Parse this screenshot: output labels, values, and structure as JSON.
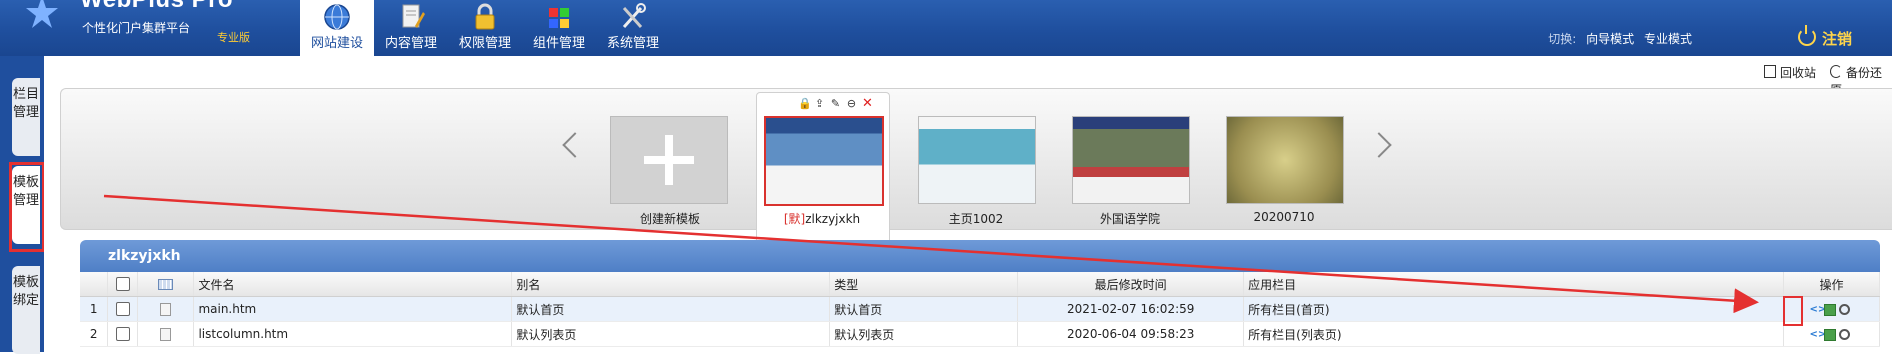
{
  "header": {
    "brand": "WebPlus Pro",
    "subtitle": "个性化门户集群平台",
    "edition": "专业版",
    "nav": [
      {
        "label": "网站建设",
        "icon": "globe-icon",
        "active": true
      },
      {
        "label": "内容管理",
        "icon": "document-edit-icon",
        "active": false
      },
      {
        "label": "权限管理",
        "icon": "lock-icon",
        "active": false
      },
      {
        "label": "组件管理",
        "icon": "components-icon",
        "active": false
      },
      {
        "label": "系统管理",
        "icon": "tools-icon",
        "active": false
      }
    ],
    "mode_label": "切换:",
    "modes": [
      "向导模式",
      "专业模式"
    ],
    "logout": "注销"
  },
  "sidebar": {
    "tabs": [
      {
        "label": "栏目管理",
        "active": false
      },
      {
        "label": "模板管理",
        "active": true
      },
      {
        "label": "模板绑定",
        "active": false
      }
    ]
  },
  "toolbar": {
    "recycle": "回收站",
    "backup": "备份还原"
  },
  "templates": [
    {
      "label": "创建新模板",
      "kind": "new"
    },
    {
      "default_tag": "[默]",
      "label": "zlkzyjxkh",
      "kind": "default"
    },
    {
      "label": "主页1002",
      "kind": "template"
    },
    {
      "label": "外国语学院",
      "kind": "template"
    },
    {
      "label": "20200710",
      "kind": "template"
    }
  ],
  "file_table": {
    "title": "zlkzyjxkh",
    "columns": [
      "文件名",
      "别名",
      "类型",
      "最后修改时间",
      "应用栏目",
      "操作"
    ],
    "rows": [
      {
        "no": "1",
        "file": "main.htm",
        "alias": "默认首页",
        "type": "默认首页",
        "modified": "2021-02-07 16:02:59",
        "column": "所有栏目(首页)"
      },
      {
        "no": "2",
        "file": "listcolumn.htm",
        "alias": "默认列表页",
        "type": "默认列表页",
        "modified": "2020-06-04 09:58:23",
        "column": "所有栏目(列表页)"
      }
    ]
  },
  "colors": {
    "header_blue": "#1f4f9e",
    "panel_blue": "#5b89cc",
    "annotation_red": "#e43030",
    "accent_yellow": "#ffd54a"
  }
}
